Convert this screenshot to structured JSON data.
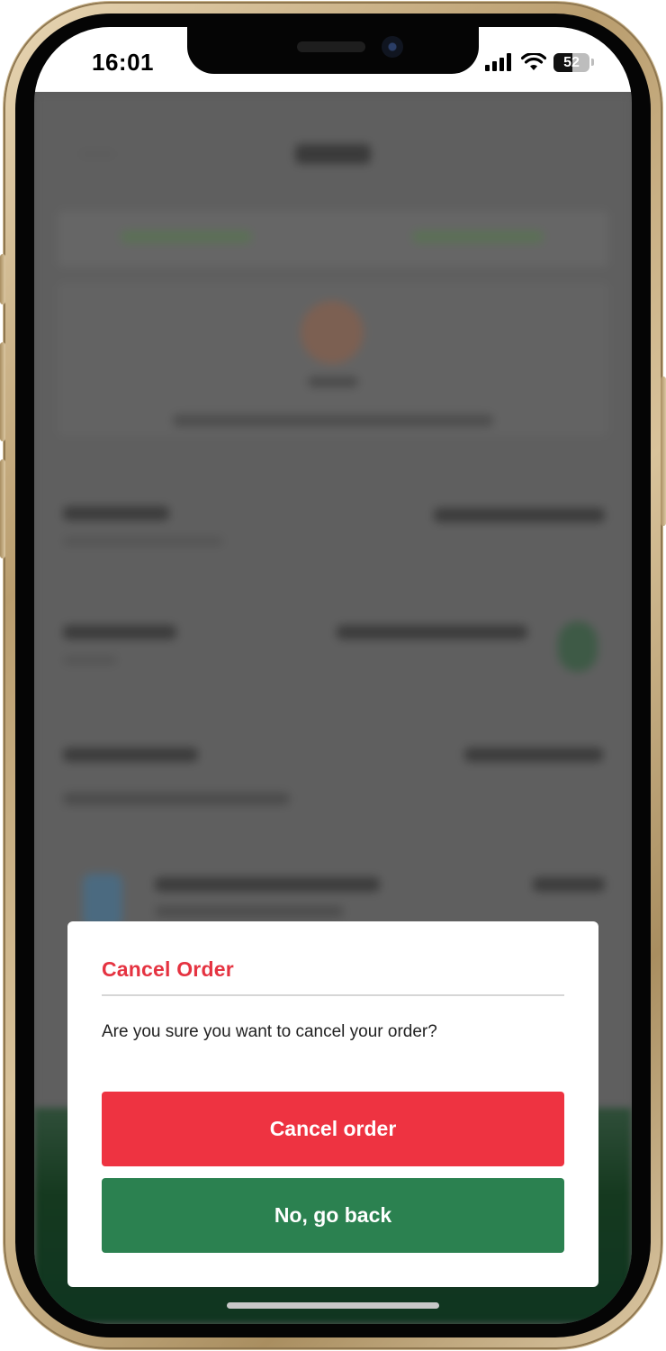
{
  "status_bar": {
    "time": "16:01",
    "battery_level": "52",
    "signal_icon": "cellular-signal-icon",
    "wifi_icon": "wifi-icon"
  },
  "dialog": {
    "title": "Cancel Order",
    "message": "Are you sure you want to cancel your order?",
    "confirm_label": "Cancel order",
    "dismiss_label": "No, go back"
  },
  "colors": {
    "danger": "#EE3341",
    "title_red": "#E53341",
    "success": "#2B8150",
    "overlay": "#5F5F5F"
  }
}
